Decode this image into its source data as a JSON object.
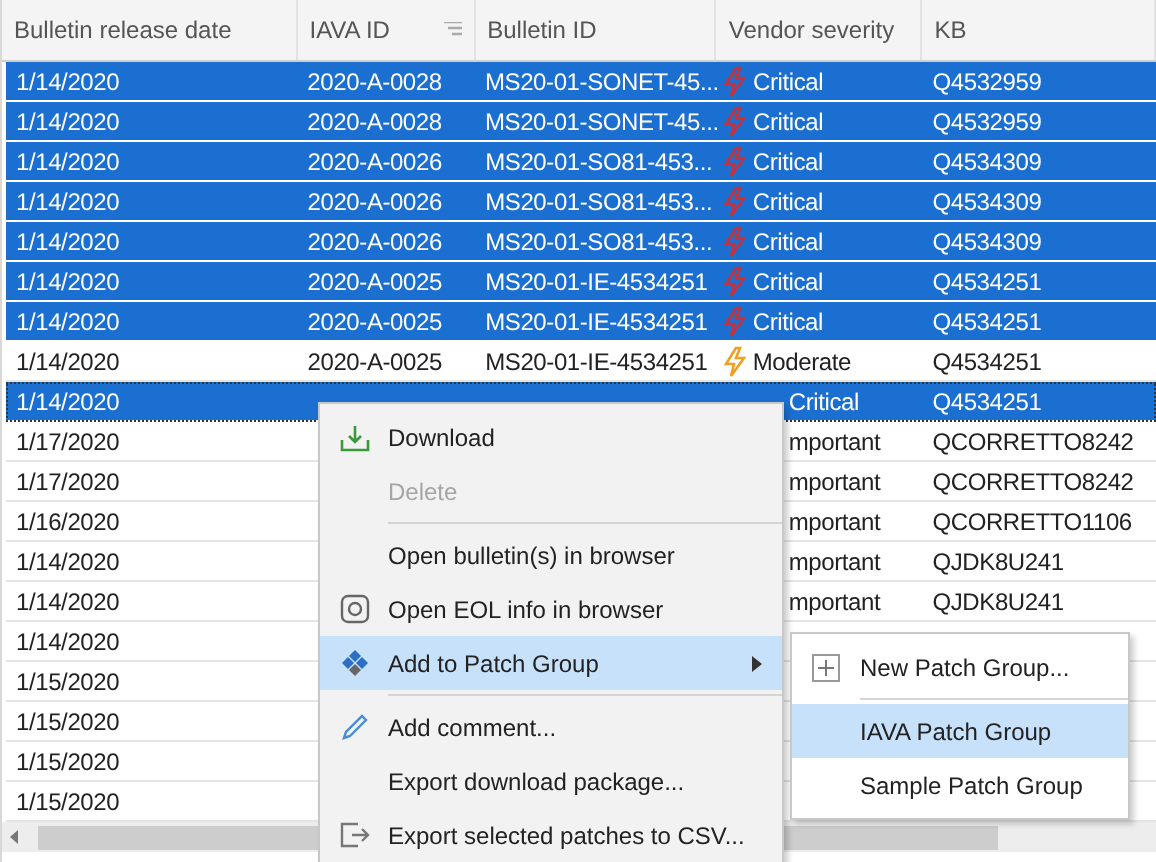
{
  "table": {
    "columns": [
      {
        "label": "Bulletin release date",
        "filter": false
      },
      {
        "label": "IAVA ID",
        "filter": true
      },
      {
        "label": "Bulletin ID",
        "filter": false
      },
      {
        "label": "Vendor severity",
        "filter": false
      },
      {
        "label": "KB",
        "filter": false
      }
    ],
    "rows": [
      {
        "date": "1/14/2020",
        "iava": "2020-A-0028",
        "bulletin": "MS20-01-SONET-45...",
        "severity": "Critical",
        "kind": "critical",
        "kb": "Q4532959",
        "selected": true,
        "focused": false
      },
      {
        "date": "1/14/2020",
        "iava": "2020-A-0028",
        "bulletin": "MS20-01-SONET-45...",
        "severity": "Critical",
        "kind": "critical",
        "kb": "Q4532959",
        "selected": true,
        "focused": false
      },
      {
        "date": "1/14/2020",
        "iava": "2020-A-0026",
        "bulletin": "MS20-01-SO81-453...",
        "severity": "Critical",
        "kind": "critical",
        "kb": "Q4534309",
        "selected": true,
        "focused": false
      },
      {
        "date": "1/14/2020",
        "iava": "2020-A-0026",
        "bulletin": "MS20-01-SO81-453...",
        "severity": "Critical",
        "kind": "critical",
        "kb": "Q4534309",
        "selected": true,
        "focused": false
      },
      {
        "date": "1/14/2020",
        "iava": "2020-A-0026",
        "bulletin": "MS20-01-SO81-453...",
        "severity": "Critical",
        "kind": "critical",
        "kb": "Q4534309",
        "selected": true,
        "focused": false
      },
      {
        "date": "1/14/2020",
        "iava": "2020-A-0025",
        "bulletin": "MS20-01-IE-4534251",
        "severity": "Critical",
        "kind": "critical",
        "kb": "Q4534251",
        "selected": true,
        "focused": false
      },
      {
        "date": "1/14/2020",
        "iava": "2020-A-0025",
        "bulletin": "MS20-01-IE-4534251",
        "severity": "Critical",
        "kind": "critical",
        "kb": "Q4534251",
        "selected": true,
        "focused": false
      },
      {
        "date": "1/14/2020",
        "iava": "2020-A-0025",
        "bulletin": "MS20-01-IE-4534251",
        "severity": "Moderate",
        "kind": "moderate",
        "kb": "Q4534251",
        "selected": false,
        "focused": false
      },
      {
        "date": "1/14/2020",
        "severity": "Critical",
        "kind": "plain",
        "kb": "Q4534251",
        "selected": true,
        "focused": true
      },
      {
        "date": "1/17/2020",
        "severity": "mportant",
        "kind": "plain",
        "kb": "QCORRETTO8242",
        "selected": false,
        "focused": false
      },
      {
        "date": "1/17/2020",
        "severity": "mportant",
        "kind": "plain",
        "kb": "QCORRETTO8242",
        "selected": false,
        "focused": false
      },
      {
        "date": "1/16/2020",
        "severity": "mportant",
        "kind": "plain",
        "kb": "QCORRETTO1106",
        "selected": false,
        "focused": false
      },
      {
        "date": "1/14/2020",
        "severity": "mportant",
        "kind": "plain",
        "kb": "QJDK8U241",
        "selected": false,
        "focused": false
      },
      {
        "date": "1/14/2020",
        "severity": "mportant",
        "kind": "plain",
        "kb": "QJDK8U241",
        "selected": false,
        "focused": false
      },
      {
        "date": "1/14/2020",
        "kind": "plain",
        "selected": false,
        "focused": false
      },
      {
        "date": "1/15/2020",
        "kind": "plain",
        "selected": false,
        "focused": false
      },
      {
        "date": "1/15/2020",
        "kind": "plain",
        "selected": false,
        "focused": false
      },
      {
        "date": "1/15/2020",
        "kind": "plain",
        "selected": false,
        "focused": false
      },
      {
        "date": "1/15/2020",
        "kind": "plain",
        "selected": false,
        "focused": false
      }
    ]
  },
  "context_menu": {
    "items": [
      {
        "kind": "item",
        "label": "Download",
        "disabled": false,
        "selected": false,
        "submenu": false
      },
      {
        "kind": "item",
        "label": "Delete",
        "disabled": true,
        "selected": false,
        "submenu": false
      },
      {
        "kind": "separator"
      },
      {
        "kind": "item",
        "label": "Open bulletin(s) in browser",
        "disabled": false,
        "selected": false,
        "submenu": false
      },
      {
        "kind": "item",
        "label": "Open EOL info in browser",
        "disabled": false,
        "selected": false,
        "submenu": false
      },
      {
        "kind": "item",
        "label": "Add to Patch Group",
        "disabled": false,
        "selected": true,
        "submenu": true
      },
      {
        "kind": "separator"
      },
      {
        "kind": "item",
        "label": "Add comment...",
        "disabled": false,
        "selected": false,
        "submenu": false
      },
      {
        "kind": "item",
        "label": "Export download package...",
        "disabled": false,
        "selected": false,
        "submenu": false
      },
      {
        "kind": "item",
        "label": "Export selected patches to CSV...",
        "disabled": false,
        "selected": false,
        "submenu": false
      }
    ]
  },
  "submenu": {
    "items": [
      {
        "kind": "item",
        "label": "New Patch Group...",
        "selected": false
      },
      {
        "kind": "separator"
      },
      {
        "kind": "item",
        "label": "IAVA  Patch Group",
        "selected": true
      },
      {
        "kind": "item",
        "label": "Sample Patch Group",
        "selected": false
      }
    ]
  }
}
